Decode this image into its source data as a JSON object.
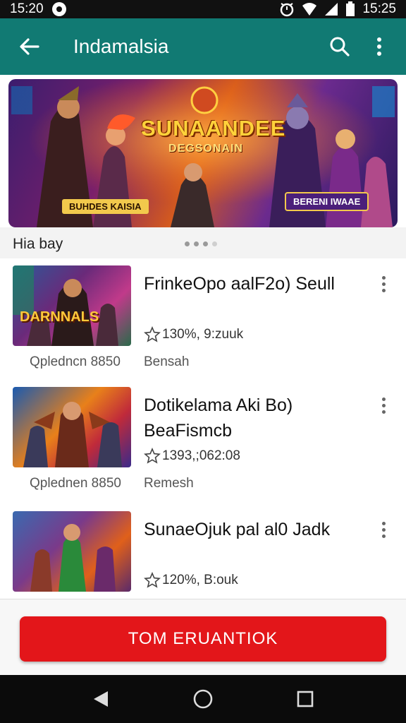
{
  "status_bar": {
    "time_left": "15:20",
    "time_right": "15:25"
  },
  "app_bar": {
    "title": "Indamalsia",
    "back_icon": "arrow-left-icon",
    "search_icon": "search-icon",
    "menu_icon": "more-vertical-icon",
    "color": "#117a73"
  },
  "banner": {
    "title": "SUNAANDEE",
    "subtitle": "DEGSONAIN",
    "badge_left": "BUHDES KAISIA",
    "badge_right": "BERENI IWAAE"
  },
  "section": {
    "title": "Hia bay",
    "pager_count": 4,
    "pager_active": 0
  },
  "games": [
    {
      "thumb_label": "DARNNALS",
      "title": "FrinkeOpo aalF2o) Seull",
      "rating": "130%, 9:zuuk",
      "meta": "Qpledncn 8850",
      "status": "Bensah"
    },
    {
      "thumb_label": "",
      "title": "Dotikelama Aki Bo) BeaFismcb",
      "rating": "1393,;062:08",
      "meta": "Qplednen 8850",
      "status": "Remesh"
    },
    {
      "thumb_label": "",
      "title": "SunaeOjuk pal al0 Jadk",
      "rating": "120%, B:ouk",
      "meta": "",
      "status": ""
    }
  ],
  "cta": {
    "label": "TOM ERUANTIOK",
    "color": "#e3161a"
  },
  "nav": {
    "back_icon": "triangle-back-icon",
    "home_icon": "circle-home-icon",
    "recent_icon": "square-recent-icon"
  }
}
